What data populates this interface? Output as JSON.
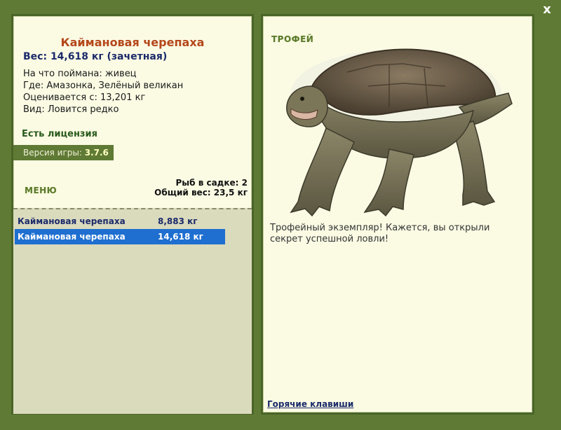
{
  "fish": {
    "name": "Каймановая черепаха",
    "weight_line": "Вес: 14,618 кг (зачетная)",
    "caught_on": "На что поймана: живец",
    "location": "Где: Амазонка, Зелёный великан",
    "rated_from": "Оценивается с: 13,201 кг",
    "species": "Вид: Ловится редко"
  },
  "license_text": "Есть лицензия",
  "version": {
    "label": "Версия игры:",
    "value": "3.7.6"
  },
  "menu_label": "МЕНЮ",
  "keepnet": {
    "count_line": "Рыб в садке: 2",
    "total_line": "Общий вес: 23,5 кг"
  },
  "catch_list": [
    {
      "name": "Каймановая черепаха",
      "weight": "8,883 кг"
    },
    {
      "name": "Каймановая черепаха",
      "weight": "14,618 кг"
    }
  ],
  "selected_index": 1,
  "trophy_label": "ТРОФЕЙ",
  "trophy_message": "Трофейный экземпляр! Кажется, вы открыли секрет успешной ловли!",
  "hotkeys_link": "Горячие клавиши",
  "close_label": "x",
  "colors": {
    "frame": "#5f7a34",
    "panel": "#fbfbe4",
    "selection": "#1e6fd0",
    "fish_name": "#b5471b",
    "weight": "#1b2a6a"
  }
}
